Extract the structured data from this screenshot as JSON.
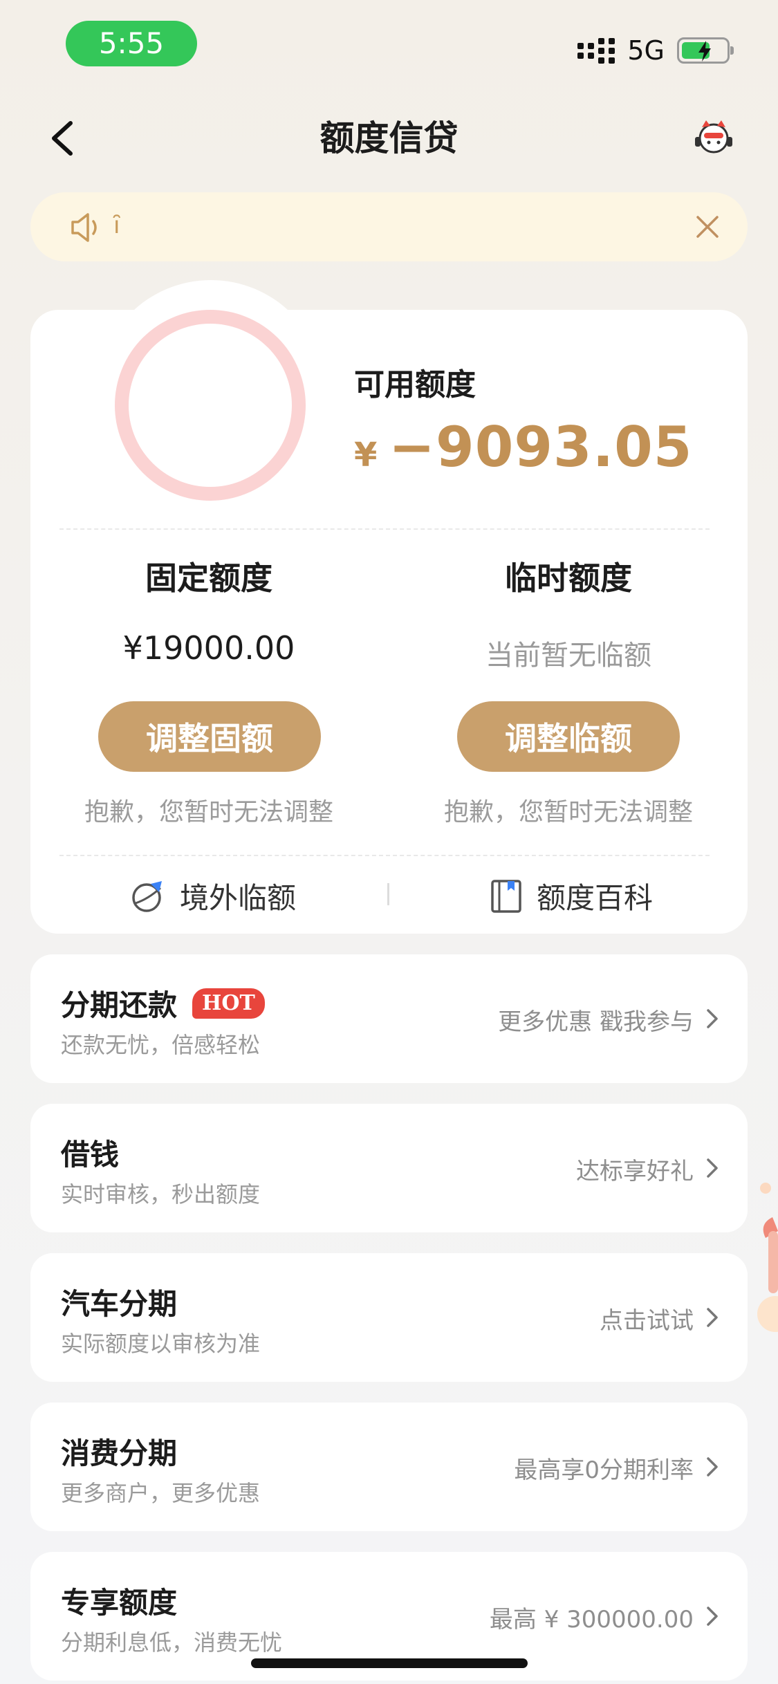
{
  "status_bar": {
    "time": "5:55",
    "network": "5G"
  },
  "header": {
    "title": "额度信贷"
  },
  "notice": {
    "text": "ȋ"
  },
  "credit": {
    "available_label": "可用额度",
    "currency": "¥",
    "available_value": "−9093.05",
    "fixed": {
      "title": "固定额度",
      "value": "¥19000.00",
      "button": "调整固额",
      "note": "抱歉，您暂时无法调整"
    },
    "temp": {
      "title": "临时额度",
      "value": "当前暂无临额",
      "button": "调整临额",
      "note": "抱歉，您暂时无法调整"
    },
    "links": {
      "overseas": "境外临额",
      "wiki": "额度百科"
    }
  },
  "list": [
    {
      "title": "分期还款",
      "badge": "HOT",
      "sub": "还款无忧，倍感轻松",
      "right": "更多优惠 戳我参与"
    },
    {
      "title": "借钱",
      "sub": "实时审核，秒出额度",
      "right": "达标享好礼"
    },
    {
      "title": "汽车分期",
      "sub": "实际额度以审核为准",
      "right": "点击试试"
    },
    {
      "title": "消费分期",
      "sub": "更多商户，更多优惠",
      "right": "最高享0分期利率"
    },
    {
      "title": "专享额度",
      "sub": "分期利息低，消费无忧",
      "right": "最高 ¥ 300000.00"
    }
  ],
  "colors": {
    "accent": "#c29155",
    "button": "#c9a06c",
    "hot": "#e8453c",
    "ring": "#fbd3d3"
  }
}
